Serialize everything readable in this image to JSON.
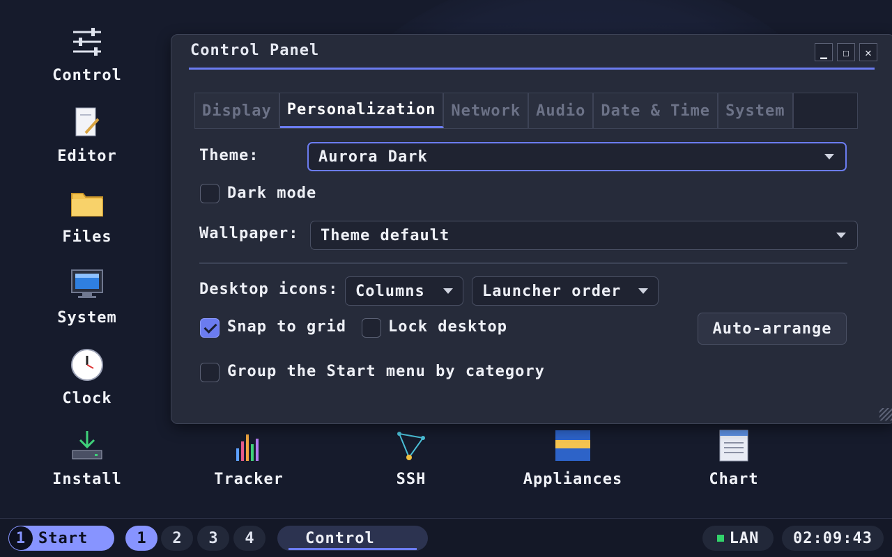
{
  "desktop": {
    "icons": [
      {
        "label": "Control",
        "icon": "sliders-icon"
      },
      {
        "label": "Editor",
        "icon": "document-pencil-icon"
      },
      {
        "label": "Files",
        "icon": "folder-icon"
      },
      {
        "label": "System",
        "icon": "monitor-icon"
      },
      {
        "label": "Clock",
        "icon": "clock-icon"
      },
      {
        "label": "Install",
        "icon": "download-tray-icon"
      },
      {
        "label": "Tracker",
        "icon": "bar-chart-icon"
      },
      {
        "label": "SSH",
        "icon": "network-triangle-icon"
      },
      {
        "label": "Appliances",
        "icon": "appliances-icon"
      },
      {
        "label": "Chart",
        "icon": "chart-document-icon"
      }
    ]
  },
  "window": {
    "title": "Control Panel",
    "controls": {
      "minimize": "▁",
      "maximize": "☐",
      "close": "✕"
    },
    "tabs": [
      "Display",
      "Personalization",
      "Network",
      "Audio",
      "Date & Time",
      "System"
    ],
    "active_tab": "Personalization",
    "theme": {
      "label": "Theme:",
      "value": "Aurora Dark"
    },
    "dark_mode": {
      "label": "Dark mode",
      "checked": false
    },
    "wallpaper": {
      "label": "Wallpaper:",
      "value": "Theme default"
    },
    "desktop_icons": {
      "label": "Desktop icons:",
      "layout": "Columns",
      "order": "Launcher order"
    },
    "snap_to_grid": {
      "label": "Snap to grid",
      "checked": true
    },
    "lock_desktop": {
      "label": "Lock desktop",
      "checked": false
    },
    "auto_arrange": "Auto-arrange",
    "group_start": {
      "label": "Group the Start menu by category",
      "checked": false
    }
  },
  "taskbar": {
    "start_number": "1",
    "start_label": "Start",
    "workspaces": [
      "1",
      "2",
      "3",
      "4"
    ],
    "active_workspace": "1",
    "task": "Control",
    "network": "LAN",
    "clock": "02:09:43"
  },
  "colors": {
    "accent": "#6b7cf0",
    "taskbar_accent": "#8794ff",
    "network_ok": "#32d36b"
  }
}
